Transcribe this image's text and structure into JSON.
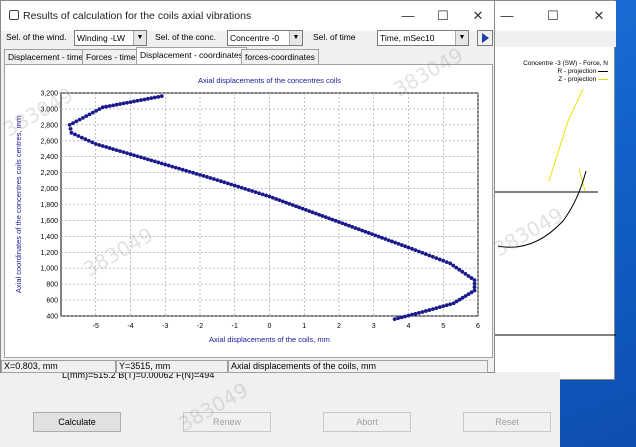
{
  "main_window": {
    "title": "Results of calculation for the coils axial vibrations",
    "controls": {
      "minimize": "—",
      "maximize": "☐",
      "close": "✕"
    },
    "sel_wind_label": "Sel. of the wind.",
    "sel_wind_value": "Winding -LW",
    "sel_conc_label": "Sel. of the conc.",
    "sel_conc_value": "Concentre -0",
    "sel_time_label": "Sel. of time",
    "sel_time_value": "Time, mSec10",
    "tabs": [
      "Displacement - time",
      "Forces - time",
      "Displacement - coordinates",
      "forces-coordinates"
    ],
    "active_tab": 2
  },
  "status": {
    "x": "X=0.803, mm",
    "y": "Y=3515, mm",
    "label": "Axial displacements of the coils, mm",
    "hidden_text": "L(mm)=515.2 B(T)=0.00062 F(N)=494"
  },
  "bottom": {
    "calculate": "Calculate",
    "renew": "Renew",
    "abort": "Abort",
    "reset": "Reset"
  },
  "back_window": {
    "controls": {
      "minimize": "—",
      "maximize": "☐",
      "close": "✕"
    },
    "legend_title": "Concentre -3 (SW) - Force, N",
    "legend_r": "R - projection",
    "legend_z": "Z - projection",
    "legend_r_color": "#000000",
    "legend_z_color": "#e0e000"
  },
  "watermark": "383049",
  "chart_data": {
    "type": "scatter",
    "title": "Axial displacements of the concentres coils",
    "xlabel": "Axial displacements of the coils, mm",
    "ylabel": "Axial coordinates of the concentres coils centres, mm",
    "xlim": [
      -6,
      6
    ],
    "ylim": [
      400,
      3200
    ],
    "xticks": [
      -5,
      -4,
      -3,
      -2,
      -1,
      0,
      1,
      2,
      3,
      4,
      5,
      6
    ],
    "yticks": [
      400,
      600,
      800,
      1000,
      1200,
      1400,
      1600,
      1800,
      2000,
      2200,
      2400,
      2600,
      2800,
      3000,
      3200
    ],
    "grid": true,
    "marker_color": "#1a1a8c",
    "curve": [
      {
        "x": -3.1,
        "y": 3160
      },
      {
        "x": -4.8,
        "y": 3020
      },
      {
        "x": -5.75,
        "y": 2800
      },
      {
        "x": -5.7,
        "y": 2700
      },
      {
        "x": -5.0,
        "y": 2560
      },
      {
        "x": -3.6,
        "y": 2380
      },
      {
        "x": -1.6,
        "y": 2120
      },
      {
        "x": 0.0,
        "y": 1900
      },
      {
        "x": 2.0,
        "y": 1580
      },
      {
        "x": 4.0,
        "y": 1260
      },
      {
        "x": 5.2,
        "y": 1060
      },
      {
        "x": 5.9,
        "y": 850
      },
      {
        "x": 5.9,
        "y": 720
      },
      {
        "x": 5.3,
        "y": 560
      },
      {
        "x": 4.4,
        "y": 450
      },
      {
        "x": 3.6,
        "y": 360
      }
    ]
  }
}
